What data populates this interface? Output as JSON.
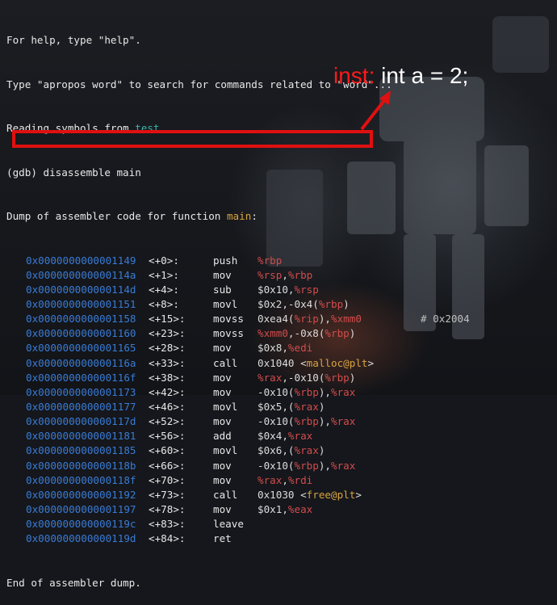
{
  "terminal": {
    "header_lines": [
      "For help, type \"help\".",
      "Type \"apropos word\" to search for commands related to \"word\"..."
    ],
    "reading_prefix": "Reading symbols from ",
    "reading_file": "test",
    "reading_suffix": "...",
    "gdb_command": "(gdb) disassemble main",
    "dump_prefix": "Dump of assembler code for function ",
    "dump_function": "main",
    "dump_suffix": ":",
    "instructions": [
      {
        "addr": "0x0000000000001149",
        "off": "<+0>:",
        "mn": "push",
        "ops": [
          [
            "r",
            "%rbp"
          ]
        ]
      },
      {
        "addr": "0x000000000000114a",
        "off": "<+1>:",
        "mn": "mov",
        "ops": [
          [
            "r",
            "%rsp"
          ],
          [
            "p",
            ","
          ],
          [
            "r",
            "%rbp"
          ]
        ]
      },
      {
        "addr": "0x000000000000114d",
        "off": "<+4>:",
        "mn": "sub",
        "ops": [
          [
            "p",
            "$0x10,"
          ],
          [
            "r",
            "%rsp"
          ]
        ]
      },
      {
        "addr": "0x0000000000001151",
        "off": "<+8>:",
        "mn": "movl",
        "ops": [
          [
            "p",
            "$0x2,-0x4("
          ],
          [
            "r",
            "%rbp"
          ],
          [
            "p",
            ")"
          ]
        ]
      },
      {
        "addr": "0x0000000000001158",
        "off": "<+15>:",
        "mn": "movss",
        "ops": [
          [
            "p",
            "0xea4("
          ],
          [
            "r",
            "%rip"
          ],
          [
            "p",
            "),"
          ],
          [
            "r",
            "%xmm0"
          ]
        ],
        "comment": "# 0x2004"
      },
      {
        "addr": "0x0000000000001160",
        "off": "<+23>:",
        "mn": "movss",
        "ops": [
          [
            "r",
            "%xmm0"
          ],
          [
            "p",
            ",-0x8("
          ],
          [
            "r",
            "%rbp"
          ],
          [
            "p",
            ")"
          ]
        ]
      },
      {
        "addr": "0x0000000000001165",
        "off": "<+28>:",
        "mn": "mov",
        "ops": [
          [
            "p",
            "$0x8,"
          ],
          [
            "r",
            "%edi"
          ]
        ]
      },
      {
        "addr": "0x000000000000116a",
        "off": "<+33>:",
        "mn": "call",
        "ops": [
          [
            "p",
            "0x1040 <"
          ],
          [
            "f",
            "malloc@plt"
          ],
          [
            "p",
            ">"
          ]
        ]
      },
      {
        "addr": "0x000000000000116f",
        "off": "<+38>:",
        "mn": "mov",
        "ops": [
          [
            "r",
            "%rax"
          ],
          [
            "p",
            ",-0x10("
          ],
          [
            "r",
            "%rbp"
          ],
          [
            "p",
            ")"
          ]
        ]
      },
      {
        "addr": "0x0000000000001173",
        "off": "<+42>:",
        "mn": "mov",
        "ops": [
          [
            "p",
            "-0x10("
          ],
          [
            "r",
            "%rbp"
          ],
          [
            "p",
            "),"
          ],
          [
            "r",
            "%rax"
          ]
        ]
      },
      {
        "addr": "0x0000000000001177",
        "off": "<+46>:",
        "mn": "movl",
        "ops": [
          [
            "p",
            "$0x5,("
          ],
          [
            "r",
            "%rax"
          ],
          [
            "p",
            ")"
          ]
        ]
      },
      {
        "addr": "0x000000000000117d",
        "off": "<+52>:",
        "mn": "mov",
        "ops": [
          [
            "p",
            "-0x10("
          ],
          [
            "r",
            "%rbp"
          ],
          [
            "p",
            "),"
          ],
          [
            "r",
            "%rax"
          ]
        ]
      },
      {
        "addr": "0x0000000000001181",
        "off": "<+56>:",
        "mn": "add",
        "ops": [
          [
            "p",
            "$0x4,"
          ],
          [
            "r",
            "%rax"
          ]
        ]
      },
      {
        "addr": "0x0000000000001185",
        "off": "<+60>:",
        "mn": "movl",
        "ops": [
          [
            "p",
            "$0x6,("
          ],
          [
            "r",
            "%rax"
          ],
          [
            "p",
            ")"
          ]
        ]
      },
      {
        "addr": "0x000000000000118b",
        "off": "<+66>:",
        "mn": "mov",
        "ops": [
          [
            "p",
            "-0x10("
          ],
          [
            "r",
            "%rbp"
          ],
          [
            "p",
            "),"
          ],
          [
            "r",
            "%rax"
          ]
        ]
      },
      {
        "addr": "0x000000000000118f",
        "off": "<+70>:",
        "mn": "mov",
        "ops": [
          [
            "r",
            "%rax"
          ],
          [
            "p",
            ","
          ],
          [
            "r",
            "%rdi"
          ]
        ]
      },
      {
        "addr": "0x0000000000001192",
        "off": "<+73>:",
        "mn": "call",
        "ops": [
          [
            "p",
            "0x1030 <"
          ],
          [
            "f",
            "free@plt"
          ],
          [
            "p",
            ">"
          ]
        ]
      },
      {
        "addr": "0x0000000000001197",
        "off": "<+78>:",
        "mn": "mov",
        "ops": [
          [
            "p",
            "$0x1,"
          ],
          [
            "r",
            "%eax"
          ]
        ]
      },
      {
        "addr": "0x000000000000119c",
        "off": "<+83>:",
        "mn": "leave",
        "ops": []
      },
      {
        "addr": "0x000000000000119d",
        "off": "<+84>:",
        "mn": "ret",
        "ops": []
      }
    ],
    "footer": "End of assembler dump."
  },
  "annotation": {
    "label": "inst:",
    "code": "int a = 2;"
  },
  "colors": {
    "address": "#3a7bd5",
    "register": "#d24c4c",
    "symbol": "#d9a441",
    "filename": "#3cb4a8",
    "highlight": "#e01010"
  }
}
